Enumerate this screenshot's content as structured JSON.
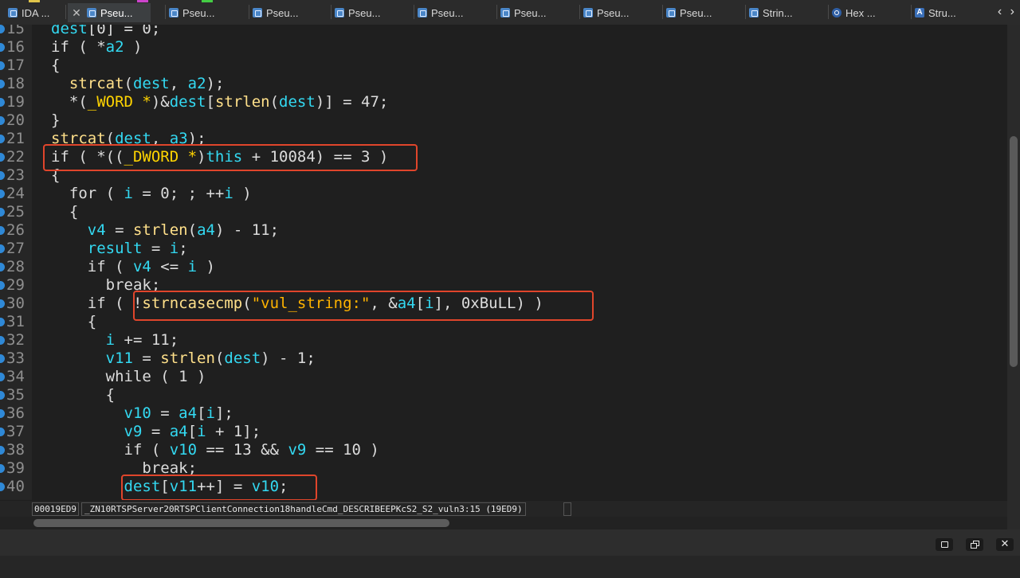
{
  "tabs": [
    {
      "label": "IDA ...",
      "icon": "ida-view-icon",
      "active": false
    },
    {
      "label": "Pseu...",
      "icon": "pseudocode-icon",
      "active": true
    },
    {
      "label": "Pseu...",
      "icon": "pseudocode-icon",
      "active": false
    },
    {
      "label": "Pseu...",
      "icon": "pseudocode-icon",
      "active": false
    },
    {
      "label": "Pseu...",
      "icon": "pseudocode-icon",
      "active": false
    },
    {
      "label": "Pseu...",
      "icon": "pseudocode-icon",
      "active": false
    },
    {
      "label": "Pseu...",
      "icon": "pseudocode-icon",
      "active": false
    },
    {
      "label": "Pseu...",
      "icon": "pseudocode-icon",
      "active": false
    },
    {
      "label": "Pseu...",
      "icon": "pseudocode-icon",
      "active": false
    },
    {
      "label": "Strin...",
      "icon": "strings-icon",
      "active": false
    },
    {
      "label": "Hex ...",
      "icon": "hex-view-icon",
      "active": false
    },
    {
      "label": "Stru...",
      "icon": "structures-icon",
      "active": false
    }
  ],
  "nav_arrows": "‹ ›",
  "code_lines": [
    {
      "num": "15",
      "tokens": [
        [
          "v",
          "dest"
        ],
        [
          "p",
          "[0] = 0;"
        ]
      ]
    },
    {
      "num": "16",
      "tokens": [
        [
          "p",
          "if ( *"
        ],
        [
          "v",
          "a2"
        ],
        [
          "p",
          " )"
        ]
      ]
    },
    {
      "num": "17",
      "tokens": [
        [
          "p",
          "{"
        ]
      ]
    },
    {
      "num": "18",
      "tokens": [
        [
          "p",
          "  "
        ],
        [
          "f",
          "strcat"
        ],
        [
          "p",
          "("
        ],
        [
          "v",
          "dest"
        ],
        [
          "p",
          ", "
        ],
        [
          "v",
          "a2"
        ],
        [
          "p",
          ");"
        ]
      ]
    },
    {
      "num": "19",
      "tokens": [
        [
          "p",
          "  *("
        ],
        [
          "t",
          "_WORD *"
        ],
        [
          "p",
          ")&"
        ],
        [
          "v",
          "dest"
        ],
        [
          "p",
          "["
        ],
        [
          "f",
          "strlen"
        ],
        [
          "p",
          "("
        ],
        [
          "v",
          "dest"
        ],
        [
          "p",
          ")] = 47;"
        ]
      ]
    },
    {
      "num": "20",
      "tokens": [
        [
          "p",
          "}"
        ]
      ]
    },
    {
      "num": "21",
      "tokens": [
        [
          "f",
          "strcat"
        ],
        [
          "p",
          "("
        ],
        [
          "v",
          "dest"
        ],
        [
          "p",
          ", "
        ],
        [
          "v",
          "a3"
        ],
        [
          "p",
          ");"
        ]
      ]
    },
    {
      "num": "22",
      "tokens": [
        [
          "p",
          "if ( *(("
        ],
        [
          "t",
          "_DWORD *"
        ],
        [
          "p",
          ")"
        ],
        [
          "v",
          "this"
        ],
        [
          "p",
          " + 10084) == 3 )"
        ]
      ]
    },
    {
      "num": "23",
      "tokens": [
        [
          "p",
          "{"
        ]
      ]
    },
    {
      "num": "24",
      "tokens": [
        [
          "p",
          "  for ( "
        ],
        [
          "v",
          "i"
        ],
        [
          "p",
          " = 0; ; ++"
        ],
        [
          "v",
          "i"
        ],
        [
          "p",
          " )"
        ]
      ]
    },
    {
      "num": "25",
      "tokens": [
        [
          "p",
          "  {"
        ]
      ]
    },
    {
      "num": "26",
      "tokens": [
        [
          "p",
          "    "
        ],
        [
          "v",
          "v4"
        ],
        [
          "p",
          " = "
        ],
        [
          "f",
          "strlen"
        ],
        [
          "p",
          "("
        ],
        [
          "v",
          "a4"
        ],
        [
          "p",
          ") - 11;"
        ]
      ]
    },
    {
      "num": "27",
      "tokens": [
        [
          "p",
          "    "
        ],
        [
          "v",
          "result"
        ],
        [
          "p",
          " = "
        ],
        [
          "v",
          "i"
        ],
        [
          "p",
          ";"
        ]
      ]
    },
    {
      "num": "28",
      "tokens": [
        [
          "p",
          "    if ( "
        ],
        [
          "v",
          "v4"
        ],
        [
          "p",
          " <= "
        ],
        [
          "v",
          "i"
        ],
        [
          "p",
          " )"
        ]
      ]
    },
    {
      "num": "29",
      "tokens": [
        [
          "p",
          "      break;"
        ]
      ]
    },
    {
      "num": "30",
      "tokens": [
        [
          "p",
          "    if ( !"
        ],
        [
          "f",
          "strncasecmp"
        ],
        [
          "p",
          "("
        ],
        [
          "s",
          "\"vul_string:\""
        ],
        [
          "p",
          ", &"
        ],
        [
          "v",
          "a4"
        ],
        [
          "p",
          "["
        ],
        [
          "v",
          "i"
        ],
        [
          "p",
          "], 0xBuLL) )"
        ]
      ]
    },
    {
      "num": "31",
      "tokens": [
        [
          "p",
          "    {"
        ]
      ]
    },
    {
      "num": "32",
      "tokens": [
        [
          "p",
          "      "
        ],
        [
          "v",
          "i"
        ],
        [
          "p",
          " += 11;"
        ]
      ]
    },
    {
      "num": "33",
      "tokens": [
        [
          "p",
          "      "
        ],
        [
          "v",
          "v11"
        ],
        [
          "p",
          " = "
        ],
        [
          "f",
          "strlen"
        ],
        [
          "p",
          "("
        ],
        [
          "v",
          "dest"
        ],
        [
          "p",
          ") - 1;"
        ]
      ]
    },
    {
      "num": "34",
      "tokens": [
        [
          "p",
          "      while ( 1 )"
        ]
      ]
    },
    {
      "num": "35",
      "tokens": [
        [
          "p",
          "      {"
        ]
      ]
    },
    {
      "num": "36",
      "tokens": [
        [
          "p",
          "        "
        ],
        [
          "v",
          "v10"
        ],
        [
          "p",
          " = "
        ],
        [
          "v",
          "a4"
        ],
        [
          "p",
          "["
        ],
        [
          "v",
          "i"
        ],
        [
          "p",
          "];"
        ]
      ]
    },
    {
      "num": "37",
      "tokens": [
        [
          "p",
          "        "
        ],
        [
          "v",
          "v9"
        ],
        [
          "p",
          " = "
        ],
        [
          "v",
          "a4"
        ],
        [
          "p",
          "["
        ],
        [
          "v",
          "i"
        ],
        [
          "p",
          " + 1];"
        ]
      ]
    },
    {
      "num": "38",
      "tokens": [
        [
          "p",
          "        if ( "
        ],
        [
          "v",
          "v10"
        ],
        [
          "p",
          " == 13 && "
        ],
        [
          "v",
          "v9"
        ],
        [
          "p",
          " == 10 )"
        ]
      ]
    },
    {
      "num": "39",
      "tokens": [
        [
          "p",
          "          break;"
        ]
      ]
    },
    {
      "num": "40",
      "tokens": [
        [
          "p",
          "        "
        ],
        [
          "v",
          "dest"
        ],
        [
          "p",
          "["
        ],
        [
          "v",
          "v11"
        ],
        [
          "p",
          "++] = "
        ],
        [
          "v",
          "v10"
        ],
        [
          "p",
          ";"
        ]
      ]
    }
  ],
  "status": {
    "address": "00019ED9",
    "location": "_ZN10RTSPServer20RTSPClientConnection18handleCmd_DESCRIBEEPKcS2_S2_vuln3:15 (19ED9)"
  },
  "colors": {
    "variable": "#33d9f2",
    "function": "#ffe08a",
    "type": "#ffd400",
    "string": "#ffb300",
    "highlight_box": "#e0452b",
    "line_marker": "#2f89d7"
  }
}
